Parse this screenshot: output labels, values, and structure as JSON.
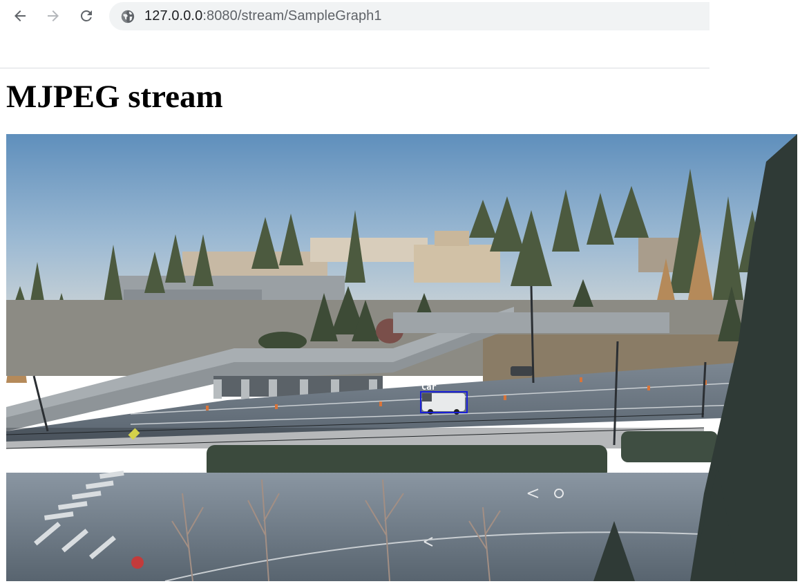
{
  "browser": {
    "url_host": "127.0.0.0",
    "url_rest": ":8080/stream/SampleGraph1",
    "back_icon": "arrow-left-icon",
    "forward_icon": "arrow-right-icon",
    "reload_icon": "reload-icon",
    "site_icon": "globe-icon"
  },
  "page": {
    "title": "MJPEG stream"
  },
  "stream": {
    "detections": [
      {
        "label": "Car",
        "color": "#1a1fd6"
      }
    ]
  }
}
